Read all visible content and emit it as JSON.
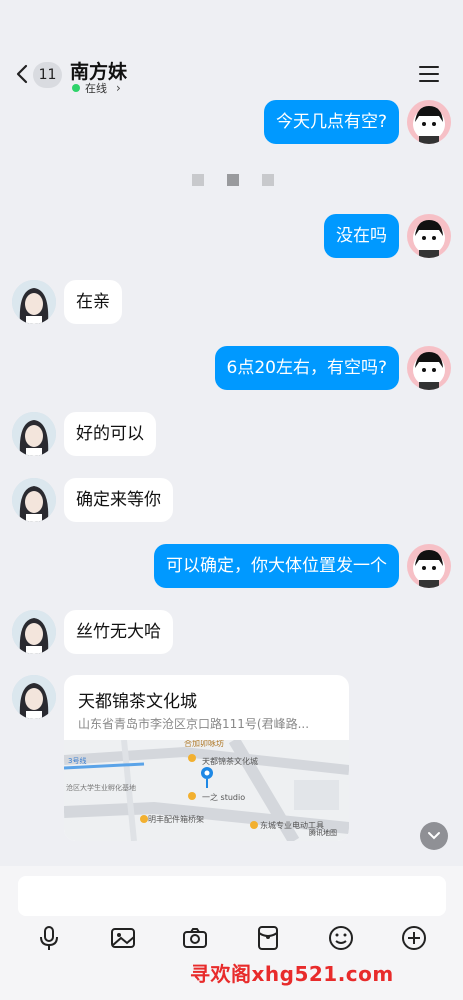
{
  "header": {
    "unread_count": "11",
    "contact_name": "南方妹",
    "status_text": "在线"
  },
  "messages": [
    {
      "side": "right",
      "text": "今天几点有空?"
    },
    {
      "side": "right",
      "text": "没在吗"
    },
    {
      "side": "left",
      "text": "在亲"
    },
    {
      "side": "right",
      "text": "6点20左右，有空吗?"
    },
    {
      "side": "left",
      "text": "好的可以"
    },
    {
      "side": "left",
      "text": "确定来等你"
    },
    {
      "side": "right",
      "text": "可以确定，你大体位置发一个"
    },
    {
      "side": "left",
      "text": "丝竹无大哈"
    }
  ],
  "location": {
    "title": "天都锦茶文化城",
    "address": "山东省青岛市李沧区京口路111号(君峰路...",
    "map_labels": {
      "a": "天都锦茶文化城",
      "b": "一之 studio",
      "c": "明丰配件箱桥架",
      "d": "东城专业电动工具",
      "e": "腾讯地图",
      "f": "沧区大学生业孵化基地",
      "g": "合加卯咏坊",
      "h": "3号线"
    }
  },
  "watermark": "寻欢阁xhg521.com",
  "colors": {
    "bubble_sent": "#0099ff",
    "bubble_received": "#ffffff",
    "background": "#eeeff3",
    "online_dot": "#2ed36a"
  }
}
